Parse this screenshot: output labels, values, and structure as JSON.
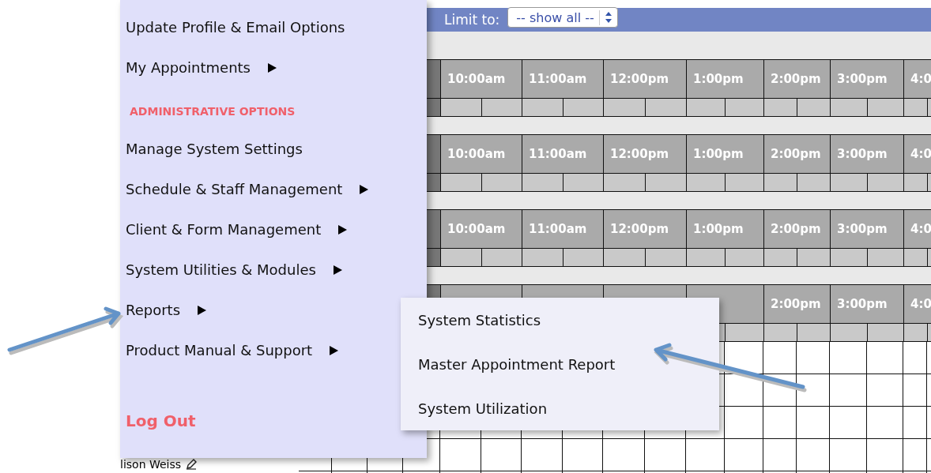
{
  "filter": {
    "label": "Limit to:",
    "value": "-- show all --"
  },
  "schedule_blocks": [
    {
      "time_headers": [
        "10:00am",
        "11:00am",
        "12:00pm",
        "1:00pm",
        "2:00pm",
        "3:00pm",
        "4:0"
      ]
    },
    {
      "time_headers": [
        "10:00am",
        "11:00am",
        "12:00pm",
        "1:00pm",
        "2:00pm",
        "3:00pm",
        "4:0"
      ]
    },
    {
      "time_headers": [
        "10:00am",
        "11:00am",
        "12:00pm",
        "1:00pm",
        "2:00pm",
        "3:00pm",
        "4:0"
      ]
    },
    {
      "time_headers": [
        "2:00pm",
        "3:00pm",
        "4:0"
      ]
    }
  ],
  "staff_name": "lison Weiss",
  "menu": {
    "items": [
      {
        "kind": "item",
        "label": "Update Profile & Email Options",
        "has_submenu": false
      },
      {
        "kind": "item",
        "label": "My Appointments",
        "has_submenu": true
      },
      {
        "kind": "heading",
        "label": "ADMINISTRATIVE OPTIONS"
      },
      {
        "kind": "item",
        "label": "Manage System Settings",
        "has_submenu": false
      },
      {
        "kind": "item",
        "label": "Schedule & Staff Management",
        "has_submenu": true
      },
      {
        "kind": "item",
        "label": "Client & Form Management",
        "has_submenu": true
      },
      {
        "kind": "item",
        "label": "System Utilities & Modules",
        "has_submenu": true
      },
      {
        "kind": "item",
        "label": "Reports",
        "has_submenu": true
      },
      {
        "kind": "item",
        "label": "Product Manual & Support",
        "has_submenu": true
      },
      {
        "kind": "logout",
        "label": "Log Out"
      }
    ]
  },
  "submenu": {
    "items": [
      "System Statistics",
      "Master Appointment Report",
      "System Utilization"
    ]
  }
}
